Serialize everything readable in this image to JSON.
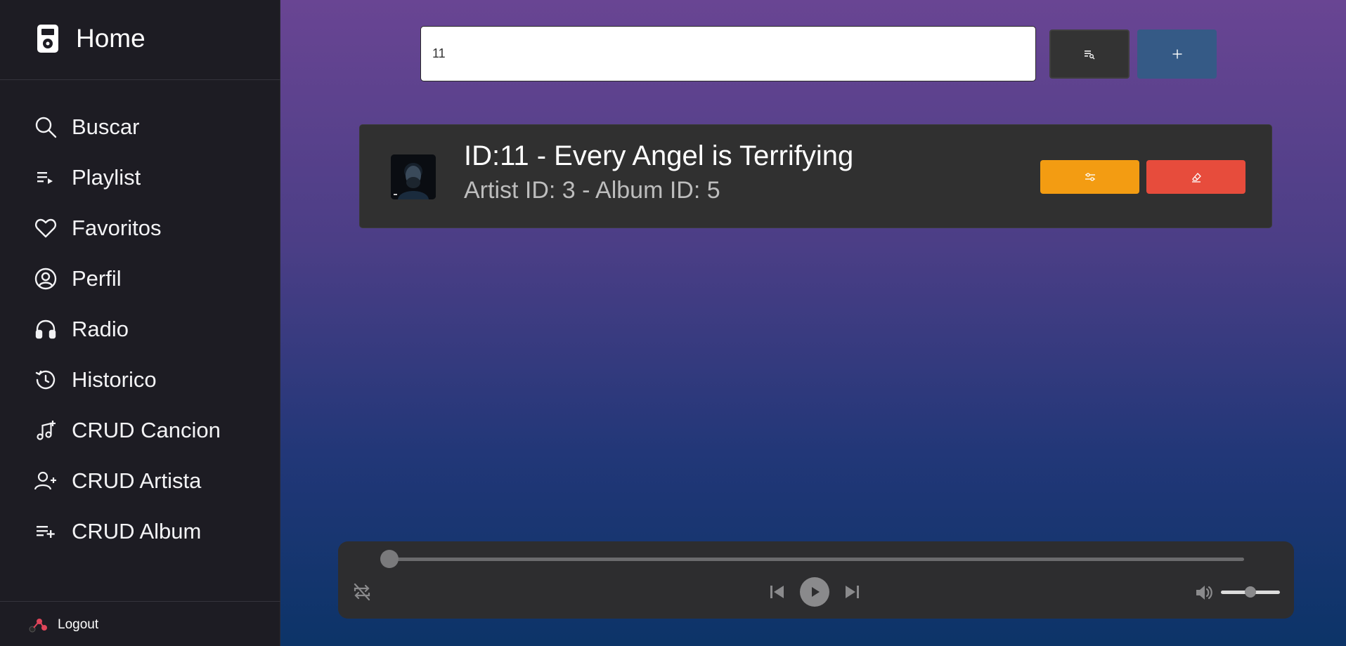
{
  "sidebar": {
    "home_label": "Home",
    "items": [
      {
        "label": "Buscar",
        "icon": "search-icon"
      },
      {
        "label": "Playlist",
        "icon": "playlist-icon"
      },
      {
        "label": "Favoritos",
        "icon": "heart-icon"
      },
      {
        "label": "Perfil",
        "icon": "user-circle-icon"
      },
      {
        "label": "Radio",
        "icon": "headphones-icon"
      },
      {
        "label": "Historico",
        "icon": "history-icon"
      },
      {
        "label": "CRUD Cancion",
        "icon": "music-add-icon"
      },
      {
        "label": "CRUD Artista",
        "icon": "user-add-icon"
      },
      {
        "label": "CRUD Album",
        "icon": "list-add-icon"
      }
    ],
    "logout_label": "Logout"
  },
  "search": {
    "value": "11"
  },
  "toolbar": {
    "list_search_icon": "list-search-icon",
    "add_icon": "plus-icon",
    "add_color": "#355a86"
  },
  "result": {
    "title": "ID:11 - Every Angel is Terrifying",
    "meta": "Artist ID: 3 - Album ID: 5",
    "edit_color": "#f39c12",
    "delete_color": "#e74c3c",
    "edit_icon": "sliders-icon",
    "delete_icon": "eraser-icon"
  },
  "player": {
    "progress": 0,
    "volume": 0.5
  },
  "colors": {
    "gradient_top": "#694593",
    "gradient_bottom": "#0c3468",
    "sidebar_bg": "#1d1c23"
  }
}
